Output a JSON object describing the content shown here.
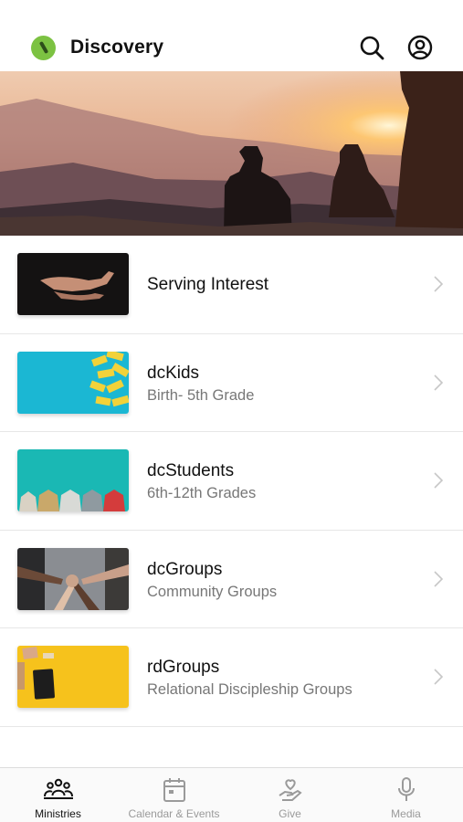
{
  "header": {
    "title": "Discovery",
    "accent_color": "#7cc242"
  },
  "hero": {
    "description_icon": "sunset-people-photo"
  },
  "items": [
    {
      "title": "Serving Interest",
      "subtitle": "",
      "thumb": "hands-photo"
    },
    {
      "title": "dcKids",
      "subtitle": "Birth- 5th Grade",
      "thumb": "lego-photo"
    },
    {
      "title": "dcStudents",
      "subtitle": "6th-12th Grades",
      "thumb": "sneakers-photo"
    },
    {
      "title": "dcGroups",
      "subtitle": "Community Groups",
      "thumb": "group-hands-photo"
    },
    {
      "title": "rdGroups",
      "subtitle": "Relational Discipleship Groups",
      "thumb": "notebook-photo"
    }
  ],
  "tabs": [
    {
      "label": "Ministries",
      "icon": "people-icon",
      "active": true
    },
    {
      "label": "Calendar & Events",
      "icon": "calendar-icon",
      "active": false
    },
    {
      "label": "Give",
      "icon": "give-hand-icon",
      "active": false
    },
    {
      "label": "Media",
      "icon": "microphone-icon",
      "active": false
    }
  ]
}
